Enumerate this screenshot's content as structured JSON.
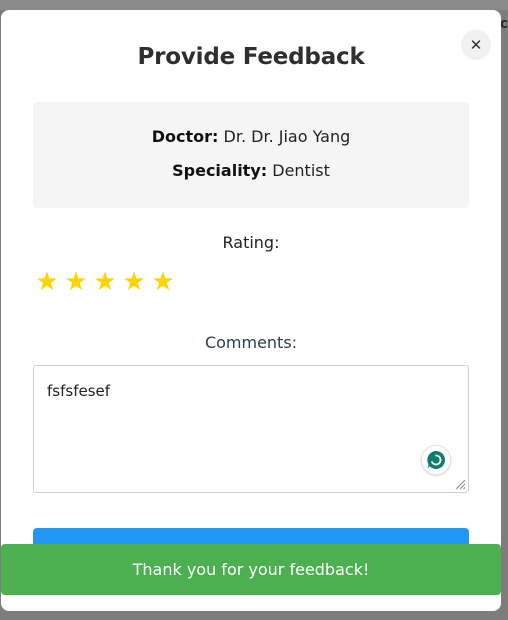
{
  "background": {
    "right_header_text": "Ac"
  },
  "modal": {
    "title": "Provide Feedback",
    "close_glyph": "✕",
    "doctor_label": "Doctor:",
    "doctor_value": "Dr. Dr. Jiao Yang",
    "speciality_label": "Speciality:",
    "speciality_value": "Dentist",
    "rating_label": "Rating:",
    "rating": {
      "value": 5,
      "max": 5,
      "glyph": "★"
    },
    "comments_label": "Comments:",
    "comments_value": "fsfsfesef",
    "submit_label": "",
    "toast_message": "Thank you for your feedback!"
  },
  "colors": {
    "star": "#ffd400",
    "submit": "#2196f3",
    "toast": "#4caf50",
    "assist_icon": "#0a7f6b"
  },
  "icons": [
    "close-icon",
    "star-icon",
    "grammar-assistant-icon",
    "resize-handle-icon"
  ]
}
